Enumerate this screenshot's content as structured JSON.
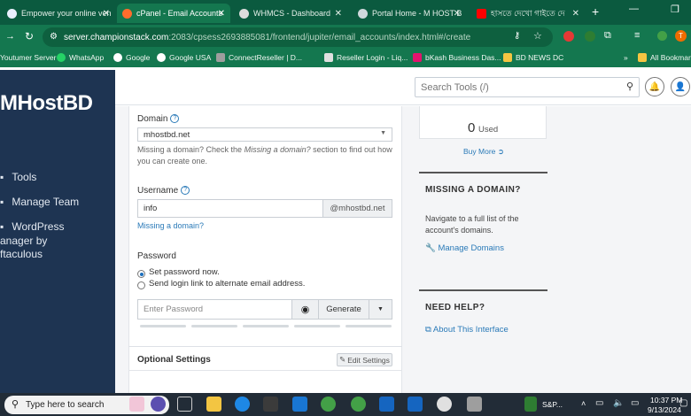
{
  "tabs": [
    {
      "title": "Empower your online ven",
      "color": "#e9f0ff"
    },
    {
      "title": "cPanel - Email Accounts",
      "color": "#ff6c2c"
    },
    {
      "title": "WHMCS - Dashboard",
      "color": "#dcdcdc"
    },
    {
      "title": "Portal Home - M HOST B",
      "color": "#cfd8dc"
    },
    {
      "title": "হাসতে দেখো গাইতে দে",
      "color": "#ff0000"
    }
  ],
  "address": {
    "host": "server.championstack.com",
    "path": ":2083/cpsess2693885081/frontend/jupiter/email_accounts/index.html#/create"
  },
  "bookmarks": [
    {
      "label": "Youtumer Server",
      "color": "#cfd8dc"
    },
    {
      "label": "WhatsApp",
      "color": "#25d366"
    },
    {
      "label": "Google",
      "color": "#ffffff"
    },
    {
      "label": "Google USA",
      "color": "#ffffff"
    },
    {
      "label": "ConnectReseller | D...",
      "color": "#9e9e9e"
    },
    {
      "label": "Reseller Login - Liq...",
      "color": "#e0e0e0"
    },
    {
      "label": "bKash Business Das...",
      "color": "#e2136e"
    },
    {
      "label": "BD NEWS DC",
      "color": "#f5c542"
    },
    {
      "label": "All Bookmarks",
      "color": "#f5c542"
    }
  ],
  "brand": "MHostBD",
  "sidebar": {
    "items": [
      "Tools",
      "Manage Team",
      "WordPress",
      "anager by",
      "ftaculous"
    ]
  },
  "search": {
    "placeholder": "Search Tools (/)"
  },
  "form": {
    "domain_label": "Domain",
    "domain_value": "mhostbd.net",
    "domain_help_1": "Missing a domain? Check the",
    "domain_help_em": "Missing a domain?",
    "domain_help_2": "section to find out how",
    "domain_help_3": "you can create one.",
    "username_label": "Username",
    "username_value": "info",
    "username_suffix": "@mhostbd.net",
    "missing_link": "Missing a domain?",
    "password_label": "Password",
    "radio_set": "Set password now.",
    "radio_send": "Send login link to alternate email address.",
    "password_placeholder": "Enter Password",
    "generate_label": "Generate",
    "optional_title": "Optional Settings",
    "edit_settings": "Edit Settings"
  },
  "right": {
    "used_count": "0",
    "used_label": "Used",
    "buy_more": "Buy More",
    "missing_title": "MISSING A DOMAIN?",
    "missing_text_1": "Navigate to a full list of the",
    "missing_text_2": "account's domains.",
    "manage_domains": "Manage Domains",
    "help_title": "NEED HELP?",
    "about_link": "About This Interface"
  },
  "taskbar": {
    "search_text": "Type here to search",
    "stock": "S&P...",
    "time": "10:37 PM",
    "date": "9/13/2024"
  },
  "colors": {
    "chrome": "#14774f",
    "sidebar": "#1e3452",
    "link": "#2a7ab8"
  }
}
